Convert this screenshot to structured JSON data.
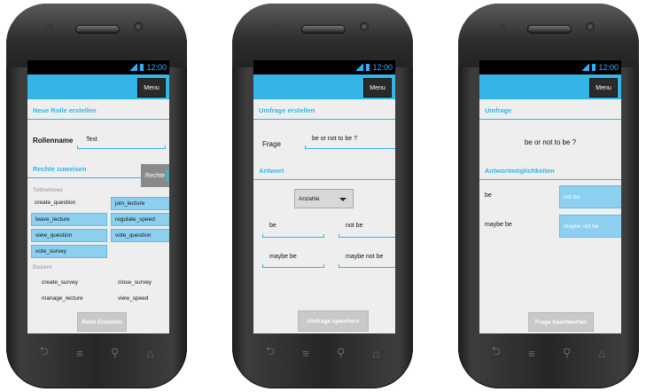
{
  "status": {
    "time": "12:00"
  },
  "menu_label": "Menu",
  "phone1": {
    "section1": "Neue Rolle erstellen",
    "rollenname_label": "Rollenname",
    "rollenname_value": "Text",
    "section2": "Rechte zuweisen",
    "rechte_tag": "Rechte",
    "teilnehmer_label": "Teilnehmer",
    "dozent_label": "Dozent",
    "perms": {
      "create_question": "create_question",
      "join_lecture": "join_lecture",
      "leave_lecture": "leave_lecture",
      "regulate_speed": "regulate_speed",
      "view_question": "view_question",
      "vote_question": "vote_question",
      "vote_survey": "vote_survey",
      "create_survey": "create_survey",
      "close_survey": "close_survey",
      "manage_lecture": "manage_lecture",
      "view_speed": "view_speed"
    },
    "button": "Rolle Erstellen"
  },
  "phone2": {
    "section1": "Umfrage erstellen",
    "frage_label": "Frage",
    "frage_value": "be or not to be ?",
    "section2": "Antwort",
    "dropdown_value": "Anzahle",
    "answers": [
      "be",
      "not be",
      "maybe be",
      "maybe not be"
    ],
    "button": "Umfrage speichern"
  },
  "phone3": {
    "section1": "Umfrage",
    "question": "be or not to be ?",
    "section2": "Antwortmöglichkeiten",
    "options": [
      {
        "label": "be",
        "choice": "not be"
      },
      {
        "label": "maybe be",
        "choice": "maybe not be"
      }
    ],
    "button": "Frage beantworten"
  },
  "nav_icons": [
    "back-icon",
    "home-icon",
    "search-icon",
    "recent-apps-icon"
  ],
  "colors": {
    "accent": "#33b5e5",
    "selected": "#8dcfee",
    "button_gray": "#c9c9c9"
  }
}
